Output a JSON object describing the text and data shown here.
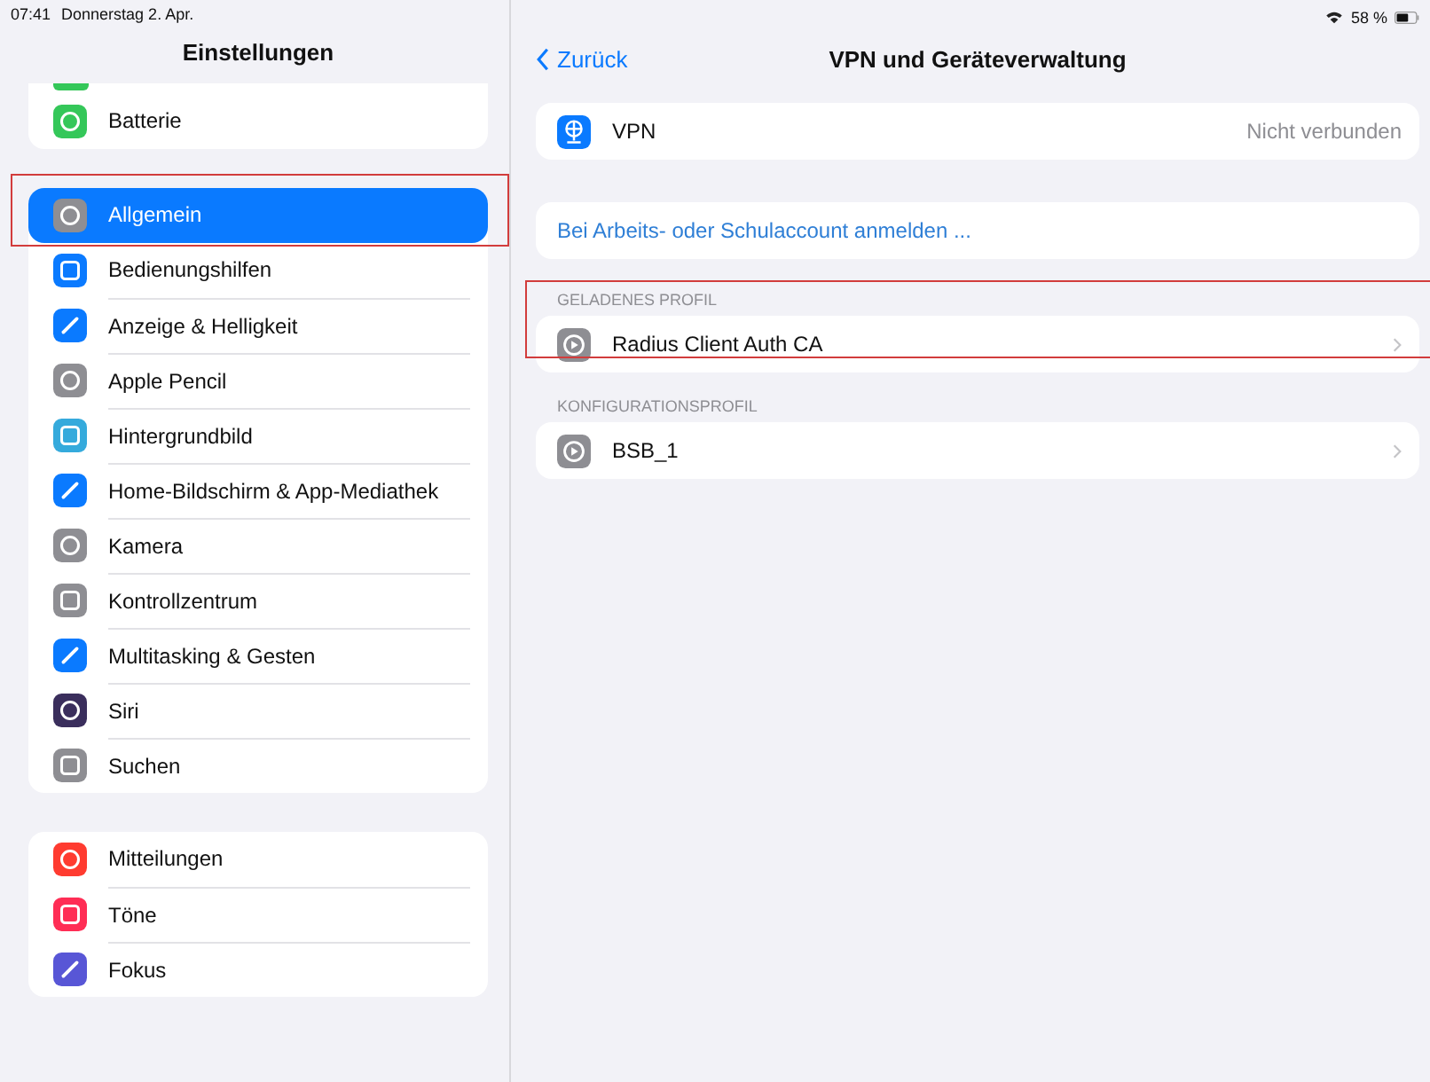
{
  "status_bar": {
    "time": "07:41",
    "date": "Donnerstag 2. Apr.",
    "battery_text": "58 %"
  },
  "sidebar": {
    "title": "Einstellungen",
    "groups": [
      {
        "cut_top": true,
        "items": [
          {
            "label": "Batterie",
            "color": "#34c759",
            "selected": false
          }
        ]
      },
      {
        "cut_top": false,
        "items": [
          {
            "label": "Allgemein",
            "color": "#8e8e93",
            "selected": true,
            "highlighted": true
          },
          {
            "label": "Bedienungshilfen",
            "color": "#0a7aff",
            "selected": false
          },
          {
            "label": "Anzeige & Helligkeit",
            "color": "#0a7aff",
            "selected": false
          },
          {
            "label": "Apple Pencil",
            "color": "#8e8e93",
            "selected": false
          },
          {
            "label": "Hintergrundbild",
            "color": "#35aadc",
            "selected": false
          },
          {
            "label": "Home-Bildschirm & App-Mediathek",
            "color": "#0a7aff",
            "selected": false
          },
          {
            "label": "Kamera",
            "color": "#8e8e93",
            "selected": false
          },
          {
            "label": "Kontrollzentrum",
            "color": "#8e8e93",
            "selected": false
          },
          {
            "label": "Multitasking & Gesten",
            "color": "#0a7aff",
            "selected": false
          },
          {
            "label": "Siri",
            "color": "#3a2e5c",
            "selected": false
          },
          {
            "label": "Suchen",
            "color": "#8e8e93",
            "selected": false
          }
        ]
      },
      {
        "cut_top": false,
        "items": [
          {
            "label": "Mitteilungen",
            "color": "#ff3b30",
            "selected": false
          },
          {
            "label": "Töne",
            "color": "#ff2d55",
            "selected": false
          },
          {
            "label": "Fokus",
            "color": "#5856d6",
            "selected": false
          }
        ]
      }
    ]
  },
  "detail": {
    "back": "Zurück",
    "title": "VPN und Geräteverwaltung",
    "vpn": {
      "label": "VPN",
      "value": "Nicht verbunden"
    },
    "signin_link": "Bei Arbeits- oder Schulaccount anmelden ...",
    "sections": [
      {
        "header": "GELADENES PROFIL",
        "highlighted": true,
        "rows": [
          {
            "label": "Radius Client Auth CA"
          }
        ]
      },
      {
        "header": "KONFIGURATIONSPROFIL",
        "highlighted": false,
        "rows": [
          {
            "label": "BSB_1"
          }
        ]
      }
    ]
  }
}
